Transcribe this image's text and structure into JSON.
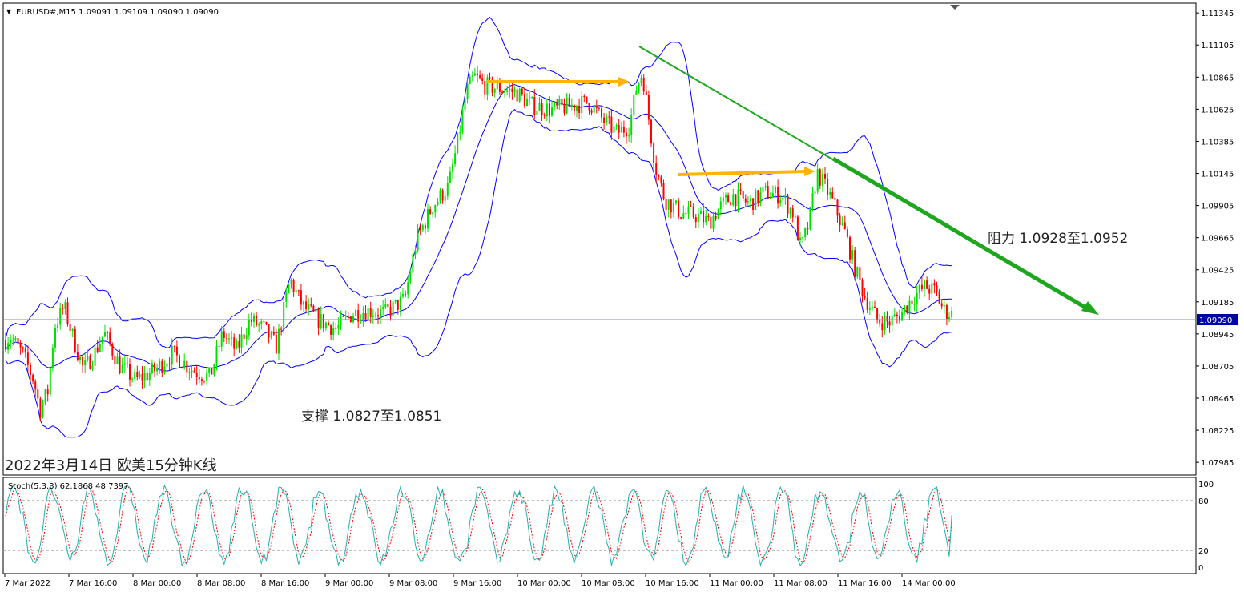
{
  "window": {
    "symbol_header": "EURUSD#,M15  1.09091 1.09109 1.09090 1.09090",
    "dropdown_glyph": "▼"
  },
  "colors": {
    "background": "#ffffff",
    "frame": "#000000",
    "bull_candle": "#00e000",
    "bear_candle": "#ff0000",
    "bollinger": "#0000ff",
    "trend_line": "#1ea71e",
    "arrow": "#ffb400",
    "current_price_line": "#7f8fa0",
    "price_tag_bg": "#0000a8",
    "stoch_main": "#20b2aa",
    "stoch_signal": "#ff0000"
  },
  "chart_data": {
    "type": "candlestick",
    "symbol": "EURUSD#",
    "timeframe": "M15",
    "ohlc_readout": {
      "open": 1.09091,
      "high": 1.09109,
      "low": 1.0909,
      "close": 1.0909
    },
    "current_price": "1.09090",
    "ylim": [
      1.0792,
      1.1137
    ],
    "y_ticks": [
      "1.11345",
      "1.11105",
      "1.10865",
      "1.10625",
      "1.10385",
      "1.10145",
      "1.09905",
      "1.09665",
      "1.09425",
      "1.09185",
      "1.08945",
      "1.08705",
      "1.08465",
      "1.08225",
      "1.07985"
    ],
    "x_ticks": [
      "7 Mar 2022",
      "7 Mar 16:00",
      "8 Mar 00:00",
      "8 Mar 08:00",
      "8 Mar 16:00",
      "9 Mar 00:00",
      "9 Mar 08:00",
      "9 Mar 16:00",
      "10 Mar 00:00",
      "10 Mar 08:00",
      "10 Mar 16:00",
      "11 Mar 00:00",
      "11 Mar 08:00",
      "11 Mar 16:00",
      "14 Mar 00:00"
    ],
    "indicator_overlay": "Bollinger Bands",
    "annotations": {
      "support": "支撑 1.0827至1.0851",
      "resistance": "阻力 1.0928至1.0952",
      "caption": "2022年3月14日 欧美15分钟K线"
    },
    "stochastic": {
      "label": "Stoch(5,3,3) 62.1868 48.7397",
      "main_value": 62.1868,
      "signal_value": 48.7397,
      "ylim": [
        0,
        100
      ],
      "y_ticks": [
        "100",
        "80",
        "20",
        "0"
      ],
      "levels": [
        80,
        20
      ]
    },
    "price_path": [
      [
        0,
        1.0885
      ],
      [
        12,
        1.0893
      ],
      [
        28,
        1.088
      ],
      [
        42,
        1.086
      ],
      [
        50,
        1.0838
      ],
      [
        60,
        1.0852
      ],
      [
        68,
        1.09
      ],
      [
        80,
        1.0915
      ],
      [
        92,
        1.089
      ],
      [
        104,
        1.0868
      ],
      [
        116,
        1.0878
      ],
      [
        130,
        1.0895
      ],
      [
        150,
        1.087
      ],
      [
        170,
        1.086
      ],
      [
        195,
        1.0868
      ],
      [
        215,
        1.088
      ],
      [
        240,
        1.0868
      ],
      [
        262,
        1.0862
      ],
      [
        278,
        1.0895
      ],
      [
        295,
        1.0882
      ],
      [
        312,
        1.0905
      ],
      [
        330,
        1.0898
      ],
      [
        345,
        1.0885
      ],
      [
        362,
        1.0935
      ],
      [
        378,
        1.0915
      ],
      [
        398,
        1.0905
      ],
      [
        420,
        1.0898
      ],
      [
        440,
        1.091
      ],
      [
        460,
        1.0912
      ],
      [
        480,
        1.091
      ],
      [
        505,
        1.092
      ],
      [
        520,
        1.0965
      ],
      [
        540,
        1.099
      ],
      [
        560,
        1.1005
      ],
      [
        572,
        1.104
      ],
      [
        582,
        1.1075
      ],
      [
        592,
        1.1087
      ],
      [
        606,
        1.108
      ],
      [
        625,
        1.1078
      ],
      [
        645,
        1.1075
      ],
      [
        665,
        1.1065
      ],
      [
        690,
        1.1062
      ],
      [
        712,
        1.1065
      ],
      [
        735,
        1.1068
      ],
      [
        752,
        1.1055
      ],
      [
        770,
        1.1045
      ],
      [
        786,
        1.105
      ],
      [
        795,
        1.108
      ],
      [
        802,
        1.109
      ],
      [
        810,
        1.1055
      ],
      [
        818,
        1.102
      ],
      [
        830,
        1.0995
      ],
      [
        850,
        1.0985
      ],
      [
        870,
        1.0983
      ],
      [
        885,
        1.0978
      ],
      [
        900,
        1.099
      ],
      [
        915,
        1.0998
      ],
      [
        935,
        1.0992
      ],
      [
        955,
        1.1
      ],
      [
        975,
        1.0998
      ],
      [
        990,
        1.0985
      ],
      [
        1000,
        1.0958
      ],
      [
        1010,
        1.0978
      ],
      [
        1020,
        1.1015
      ],
      [
        1030,
        1.1005
      ],
      [
        1042,
        1.099
      ],
      [
        1055,
        1.097
      ],
      [
        1068,
        1.0942
      ],
      [
        1080,
        1.0922
      ],
      [
        1095,
        1.0905
      ],
      [
        1110,
        1.0903
      ],
      [
        1125,
        1.091
      ],
      [
        1140,
        1.0922
      ],
      [
        1155,
        1.093
      ],
      [
        1168,
        1.0926
      ],
      [
        1178,
        1.0912
      ],
      [
        1190,
        1.0909
      ]
    ]
  }
}
